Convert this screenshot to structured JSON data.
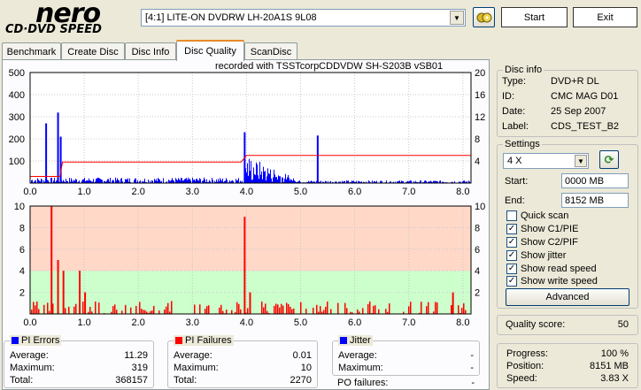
{
  "app": {
    "logo_main": "nero",
    "logo_sub": "CD·DVD SPEED"
  },
  "toolbar": {
    "drive_selected": "[4:1]  LITE-ON DVDRW LH-20A1S 9L08",
    "start_label": "Start",
    "exit_label": "Exit"
  },
  "tabs": [
    {
      "label": "Benchmark",
      "active": false
    },
    {
      "label": "Create Disc",
      "active": false
    },
    {
      "label": "Disc Info",
      "active": false
    },
    {
      "label": "Disc Quality",
      "active": true
    },
    {
      "label": "ScanDisc",
      "active": false
    }
  ],
  "recorded_with": "recorded with TSSTcorpCDDVDW SH-S203B  vSB01",
  "chart_data": [
    {
      "type": "bar",
      "name": "PI Errors",
      "x_ticks": [
        "0.0",
        "1.0",
        "2.0",
        "3.0",
        "4.0",
        "5.0",
        "6.0",
        "7.0",
        "8.0"
      ],
      "y_ticks_left": [
        "500",
        "400",
        "300",
        "200",
        "100"
      ],
      "y_ticks_right": [
        "20",
        "16",
        "12",
        "8",
        "4"
      ],
      "xlim": [
        0,
        8.15
      ],
      "ylim": [
        0,
        500
      ],
      "ylim_right": [
        0,
        20
      ],
      "bar_color": "#0000ff",
      "speed_color": "#ff0000",
      "spikes": [
        {
          "x": 0.28,
          "y": 270
        },
        {
          "x": 0.5,
          "y": 319
        },
        {
          "x": 0.55,
          "y": 210
        },
        {
          "x": 3.95,
          "y": 230
        },
        {
          "x": 5.3,
          "y": 215
        }
      ],
      "speed_points": [
        [
          0.0,
          1.2
        ],
        [
          0.55,
          1.2
        ],
        [
          0.6,
          3.8
        ],
        [
          3.9,
          3.8
        ],
        [
          4.0,
          5.0
        ],
        [
          7.9,
          5.0
        ],
        [
          8.15,
          5.0
        ]
      ]
    },
    {
      "type": "bar",
      "name": "PI Failures",
      "x_ticks": [
        "0.0",
        "1.0",
        "2.0",
        "3.0",
        "4.0",
        "5.0",
        "6.0",
        "7.0",
        "8.0"
      ],
      "y_ticks_left": [
        "10",
        "8",
        "6",
        "4",
        "2"
      ],
      "y_ticks_right": [
        "10",
        "8",
        "6",
        "4",
        "2"
      ],
      "xlim": [
        0,
        8.15
      ],
      "ylim": [
        0,
        10
      ],
      "bar_color": "#ff0000",
      "bands": [
        {
          "from": 0,
          "to": 2,
          "color": "#ccffcc"
        },
        {
          "from": 2,
          "to": 4,
          "color": "#ccffcc"
        },
        {
          "from": 4,
          "to": 10,
          "color": "#ffd8c8"
        }
      ],
      "spikes": [
        {
          "x": 0.38,
          "y": 10
        },
        {
          "x": 0.5,
          "y": 5
        },
        {
          "x": 0.6,
          "y": 4
        },
        {
          "x": 0.9,
          "y": 4
        },
        {
          "x": 1.0,
          "y": 2
        },
        {
          "x": 3.95,
          "y": 9
        },
        {
          "x": 4.05,
          "y": 2
        },
        {
          "x": 7.8,
          "y": 2
        }
      ]
    }
  ],
  "disc_info": {
    "title": "Disc info",
    "type_label": "Type:",
    "type_value": "DVD+R DL",
    "id_label": "ID:",
    "id_value": "CMC MAG D01",
    "date_label": "Date:",
    "date_value": "25 Sep 2007",
    "label_label": "Label:",
    "label_value": "CDS_TEST_B2"
  },
  "settings": {
    "title": "Settings",
    "speed": "4 X",
    "start_label": "Start:",
    "start_value": "0000 MB",
    "end_label": "End:",
    "end_value": "8152 MB",
    "checks": [
      {
        "label": "Quick scan",
        "checked": false
      },
      {
        "label": "Show C1/PIE",
        "checked": true
      },
      {
        "label": "Show C2/PIF",
        "checked": true
      },
      {
        "label": "Show jitter",
        "checked": true
      },
      {
        "label": "Show read speed",
        "checked": true
      },
      {
        "label": "Show write speed",
        "checked": true
      }
    ],
    "advanced_label": "Advanced"
  },
  "quality": {
    "label": "Quality score:",
    "value": "50"
  },
  "progress": {
    "progress_label": "Progress:",
    "progress_value": "100 %",
    "position_label": "Position:",
    "position_value": "8151 MB",
    "speed_label": "Speed:",
    "speed_value": "3.83 X"
  },
  "pi_errors": {
    "title": "PI Errors",
    "color": "#0000ff",
    "avg_label": "Average:",
    "avg": "11.29",
    "max_label": "Maximum:",
    "max": "319",
    "total_label": "Total:",
    "total": "368157"
  },
  "pi_failures": {
    "title": "PI Failures",
    "color": "#ff0000",
    "avg_label": "Average:",
    "avg": "0.01",
    "max_label": "Maximum:",
    "max": "10",
    "total_label": "Total:",
    "total": "2270"
  },
  "jitter": {
    "title": "Jitter",
    "color": "#0000ff",
    "avg_label": "Average:",
    "avg": "-",
    "max_label": "Maximum:",
    "max": "-",
    "po_label": "PO failures:",
    "po": "-"
  }
}
